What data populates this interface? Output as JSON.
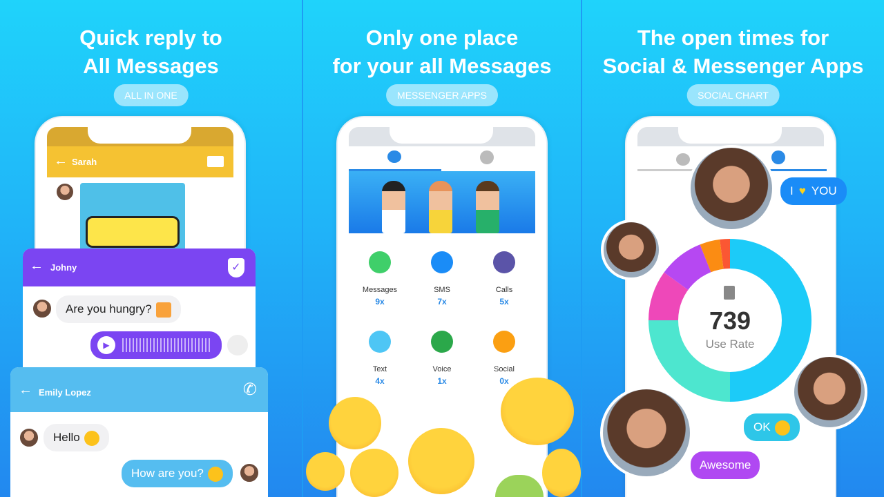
{
  "panels": [
    {
      "title": "Quick reply to\nAll Messages",
      "pill": "ALL IN ONE"
    },
    {
      "title": "Only one place\nfor your all Messages",
      "pill": "MESSENGER APPS"
    },
    {
      "title": "The open times for\nSocial & Messenger Apps",
      "pill": "SOCIAL CHART"
    }
  ],
  "chats": {
    "sarah": {
      "name": "Sarah",
      "color": "#f5c232"
    },
    "johny": {
      "name": "Johny",
      "color": "#7b45f2",
      "message": "Are you hungry?"
    },
    "emily": {
      "name": "Emily Lopez",
      "color": "#55bdf0",
      "message_in": "Hello",
      "message_out": "How are you?"
    }
  },
  "apps": [
    {
      "label": "Messages",
      "count": "9x",
      "icon": "whatsapp-icon",
      "color": "#3fcf6a"
    },
    {
      "label": "SMS",
      "count": "7x",
      "icon": "messenger-icon",
      "color": "#1a8cf7"
    },
    {
      "label": "Calls",
      "count": "5x",
      "icon": "viber-icon",
      "color": "#5b54a8"
    },
    {
      "label": "Text",
      "count": "4x",
      "icon": "send-icon",
      "color": "#4ec6f5"
    },
    {
      "label": "Voice",
      "count": "1x",
      "icon": "microphone-icon",
      "color": "#2ba84a"
    },
    {
      "label": "Social",
      "count": "0x",
      "icon": "notes-icon",
      "color": "#fb9f12"
    }
  ],
  "stats": {
    "value": "739",
    "label": "Use Rate"
  },
  "bubbles": {
    "love_left": "I",
    "love_right": "YOU",
    "ok": "OK",
    "awesome": "Awesome"
  },
  "chart_data": {
    "type": "pie",
    "values": [
      50,
      25,
      10,
      9,
      4,
      2
    ],
    "colors": [
      "#1ccbf8",
      "#4de6cf",
      "#ee48b9",
      "#b648f2",
      "#fb8c13",
      "#fb5733"
    ]
  }
}
